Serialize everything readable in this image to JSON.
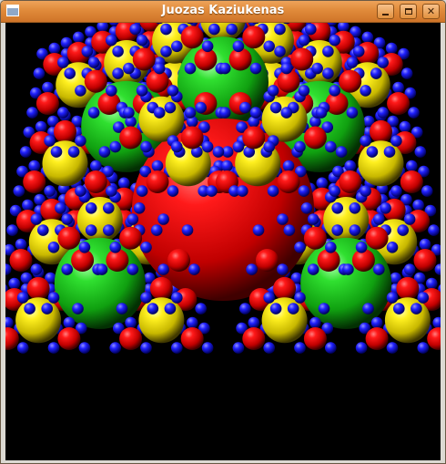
{
  "window": {
    "title": "Juozas Kaziukenas",
    "app_icon": "window-icon",
    "buttons": {
      "minimize": "minimize-icon",
      "maximize": "maximize-icon",
      "close": "close-icon"
    }
  },
  "scene": {
    "description_colors": {
      "red": "#e00000",
      "green": "#10c010",
      "yellow": "#e8e000",
      "blue": "#1010e0",
      "background": "#000000"
    },
    "content": "recursive sphere fractal"
  }
}
